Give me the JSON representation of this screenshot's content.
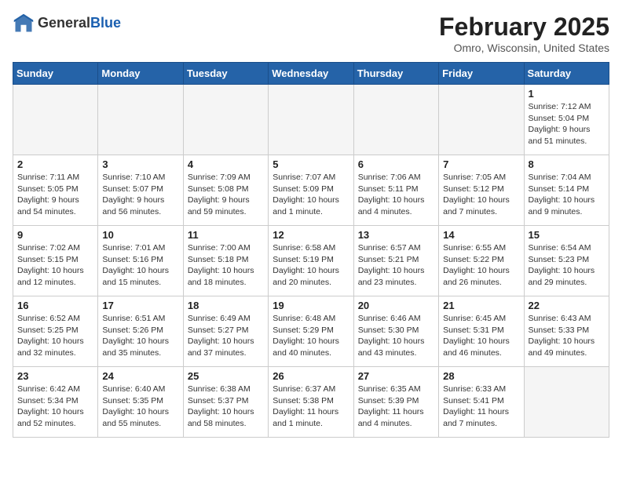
{
  "header": {
    "logo_line1": "General",
    "logo_line2": "Blue",
    "month_title": "February 2025",
    "location": "Omro, Wisconsin, United States"
  },
  "weekdays": [
    "Sunday",
    "Monday",
    "Tuesday",
    "Wednesday",
    "Thursday",
    "Friday",
    "Saturday"
  ],
  "weeks": [
    [
      {
        "day": "",
        "info": ""
      },
      {
        "day": "",
        "info": ""
      },
      {
        "day": "",
        "info": ""
      },
      {
        "day": "",
        "info": ""
      },
      {
        "day": "",
        "info": ""
      },
      {
        "day": "",
        "info": ""
      },
      {
        "day": "1",
        "info": "Sunrise: 7:12 AM\nSunset: 5:04 PM\nDaylight: 9 hours\nand 51 minutes."
      }
    ],
    [
      {
        "day": "2",
        "info": "Sunrise: 7:11 AM\nSunset: 5:05 PM\nDaylight: 9 hours\nand 54 minutes."
      },
      {
        "day": "3",
        "info": "Sunrise: 7:10 AM\nSunset: 5:07 PM\nDaylight: 9 hours\nand 56 minutes."
      },
      {
        "day": "4",
        "info": "Sunrise: 7:09 AM\nSunset: 5:08 PM\nDaylight: 9 hours\nand 59 minutes."
      },
      {
        "day": "5",
        "info": "Sunrise: 7:07 AM\nSunset: 5:09 PM\nDaylight: 10 hours\nand 1 minute."
      },
      {
        "day": "6",
        "info": "Sunrise: 7:06 AM\nSunset: 5:11 PM\nDaylight: 10 hours\nand 4 minutes."
      },
      {
        "day": "7",
        "info": "Sunrise: 7:05 AM\nSunset: 5:12 PM\nDaylight: 10 hours\nand 7 minutes."
      },
      {
        "day": "8",
        "info": "Sunrise: 7:04 AM\nSunset: 5:14 PM\nDaylight: 10 hours\nand 9 minutes."
      }
    ],
    [
      {
        "day": "9",
        "info": "Sunrise: 7:02 AM\nSunset: 5:15 PM\nDaylight: 10 hours\nand 12 minutes."
      },
      {
        "day": "10",
        "info": "Sunrise: 7:01 AM\nSunset: 5:16 PM\nDaylight: 10 hours\nand 15 minutes."
      },
      {
        "day": "11",
        "info": "Sunrise: 7:00 AM\nSunset: 5:18 PM\nDaylight: 10 hours\nand 18 minutes."
      },
      {
        "day": "12",
        "info": "Sunrise: 6:58 AM\nSunset: 5:19 PM\nDaylight: 10 hours\nand 20 minutes."
      },
      {
        "day": "13",
        "info": "Sunrise: 6:57 AM\nSunset: 5:21 PM\nDaylight: 10 hours\nand 23 minutes."
      },
      {
        "day": "14",
        "info": "Sunrise: 6:55 AM\nSunset: 5:22 PM\nDaylight: 10 hours\nand 26 minutes."
      },
      {
        "day": "15",
        "info": "Sunrise: 6:54 AM\nSunset: 5:23 PM\nDaylight: 10 hours\nand 29 minutes."
      }
    ],
    [
      {
        "day": "16",
        "info": "Sunrise: 6:52 AM\nSunset: 5:25 PM\nDaylight: 10 hours\nand 32 minutes."
      },
      {
        "day": "17",
        "info": "Sunrise: 6:51 AM\nSunset: 5:26 PM\nDaylight: 10 hours\nand 35 minutes."
      },
      {
        "day": "18",
        "info": "Sunrise: 6:49 AM\nSunset: 5:27 PM\nDaylight: 10 hours\nand 37 minutes."
      },
      {
        "day": "19",
        "info": "Sunrise: 6:48 AM\nSunset: 5:29 PM\nDaylight: 10 hours\nand 40 minutes."
      },
      {
        "day": "20",
        "info": "Sunrise: 6:46 AM\nSunset: 5:30 PM\nDaylight: 10 hours\nand 43 minutes."
      },
      {
        "day": "21",
        "info": "Sunrise: 6:45 AM\nSunset: 5:31 PM\nDaylight: 10 hours\nand 46 minutes."
      },
      {
        "day": "22",
        "info": "Sunrise: 6:43 AM\nSunset: 5:33 PM\nDaylight: 10 hours\nand 49 minutes."
      }
    ],
    [
      {
        "day": "23",
        "info": "Sunrise: 6:42 AM\nSunset: 5:34 PM\nDaylight: 10 hours\nand 52 minutes."
      },
      {
        "day": "24",
        "info": "Sunrise: 6:40 AM\nSunset: 5:35 PM\nDaylight: 10 hours\nand 55 minutes."
      },
      {
        "day": "25",
        "info": "Sunrise: 6:38 AM\nSunset: 5:37 PM\nDaylight: 10 hours\nand 58 minutes."
      },
      {
        "day": "26",
        "info": "Sunrise: 6:37 AM\nSunset: 5:38 PM\nDaylight: 11 hours\nand 1 minute."
      },
      {
        "day": "27",
        "info": "Sunrise: 6:35 AM\nSunset: 5:39 PM\nDaylight: 11 hours\nand 4 minutes."
      },
      {
        "day": "28",
        "info": "Sunrise: 6:33 AM\nSunset: 5:41 PM\nDaylight: 11 hours\nand 7 minutes."
      },
      {
        "day": "",
        "info": ""
      }
    ]
  ]
}
